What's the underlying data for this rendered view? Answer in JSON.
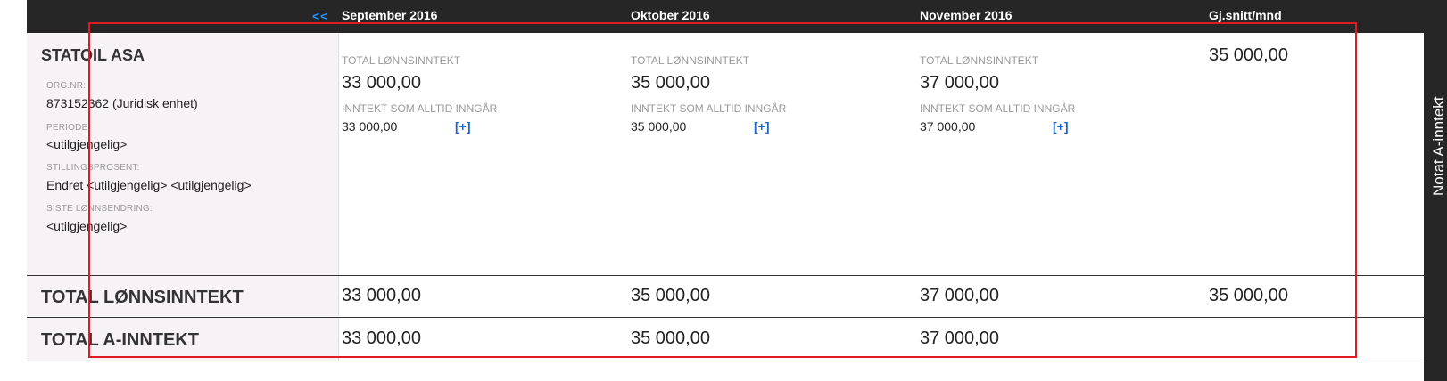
{
  "header": {
    "nav_prev": "<<",
    "months": [
      "September 2016",
      "Oktober 2016",
      "November 2016"
    ],
    "average_label": "Gj.snitt/mnd"
  },
  "side_tab": {
    "label": "Notat A-inntekt"
  },
  "employer": {
    "name": "STATOIL ASA",
    "fields": [
      {
        "label": "ORG.NR:",
        "value": "873152362 (Juridisk enhet)"
      },
      {
        "label": "PERIODE:",
        "value": "<utilgjengelig>"
      },
      {
        "label": "STILLINGSPROSENT:",
        "value": "Endret <utilgjengelig> <utilgjengelig>"
      },
      {
        "label": "SISTE LØNNSENDRING:",
        "value": "<utilgjengelig>"
      }
    ]
  },
  "month_columns": [
    {
      "total_label": "TOTAL LØNNSINNTEKT",
      "total_value": "33 000,00",
      "always_label": "INNTEKT SOM ALLTID INNGÅR",
      "always_value": "33 000,00",
      "expand_label": "[+]"
    },
    {
      "total_label": "TOTAL LØNNSINNTEKT",
      "total_value": "35 000,00",
      "always_label": "INNTEKT SOM ALLTID INNGÅR",
      "always_value": "35 000,00",
      "expand_label": "[+]"
    },
    {
      "total_label": "TOTAL LØNNSINNTEKT",
      "total_value": "37 000,00",
      "always_label": "INNTEKT SOM ALLTID INNGÅR",
      "always_value": "37 000,00",
      "expand_label": "[+]"
    }
  ],
  "employer_average": "35 000,00",
  "summary_rows": [
    {
      "title": "TOTAL LØNNSINNTEKT",
      "values": [
        "33 000,00",
        "35 000,00",
        "37 000,00"
      ],
      "average": "35 000,00"
    },
    {
      "title": "TOTAL A-INNTEKT",
      "values": [
        "33 000,00",
        "35 000,00",
        "37 000,00"
      ],
      "average": ""
    }
  ],
  "colors": {
    "header_bg": "#262626",
    "panel_bg": "#f6f2f6",
    "link_blue": "#1a66cc",
    "highlight_red": "#e01b24"
  }
}
